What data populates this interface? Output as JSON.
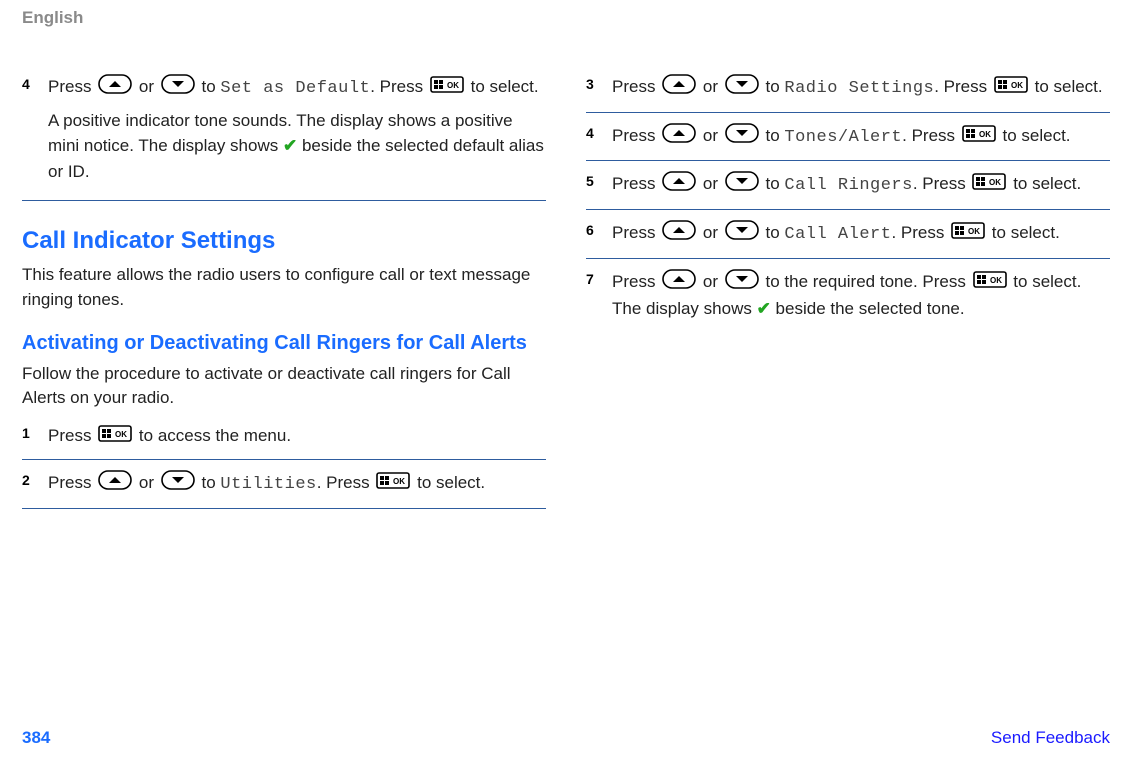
{
  "header": "English",
  "footer": {
    "page": "384",
    "link": "Send Feedback"
  },
  "left": {
    "step4": {
      "num": "4",
      "p1_a": "Press ",
      "p1_b": " or ",
      "p1_c": " to ",
      "menu": "Set as Default",
      "p1_d": ". Press ",
      "p1_e": " to select.",
      "p2_a": "A positive indicator tone sounds. The display shows a positive mini notice. The display shows ",
      "p2_b": " beside the selected default alias or ID."
    },
    "h2": "Call Indicator Settings",
    "h2_body": "This feature allows the radio users to configure call or text message ringing tones.",
    "h3": "Activating or Deactivating Call Ringers for Call Alerts",
    "h3_body": "Follow the procedure to activate or deactivate call ringers for Call Alerts on your radio.",
    "step1": {
      "num": "1",
      "a": "Press ",
      "b": " to access the menu."
    },
    "step2": {
      "num": "2",
      "a": "Press ",
      "b": " or ",
      "c": " to ",
      "menu": "Utilities",
      "d": ". Press ",
      "e": " to select."
    }
  },
  "right": {
    "step3": {
      "num": "3",
      "a": "Press ",
      "b": " or ",
      "c": " to ",
      "menu": "Radio Settings",
      "d": ". Press ",
      "e": " to select."
    },
    "step4": {
      "num": "4",
      "a": "Press ",
      "b": " or ",
      "c": " to ",
      "menu": "Tones/Alert",
      "d": ". Press ",
      "e": " to select."
    },
    "step5": {
      "num": "5",
      "a": "Press ",
      "b": " or ",
      "c": " to ",
      "menu": "Call Ringers",
      "d": ". Press ",
      "e": " to select."
    },
    "step6": {
      "num": "6",
      "a": "Press ",
      "b": " or ",
      "c": " to ",
      "menu": "Call Alert",
      "d": ". Press ",
      "e": " to select."
    },
    "step7": {
      "num": "7",
      "a": "Press ",
      "b": " or ",
      "c": " to the required tone. Press ",
      "d": " to select. The display shows ",
      "e": " beside the selected tone."
    }
  }
}
